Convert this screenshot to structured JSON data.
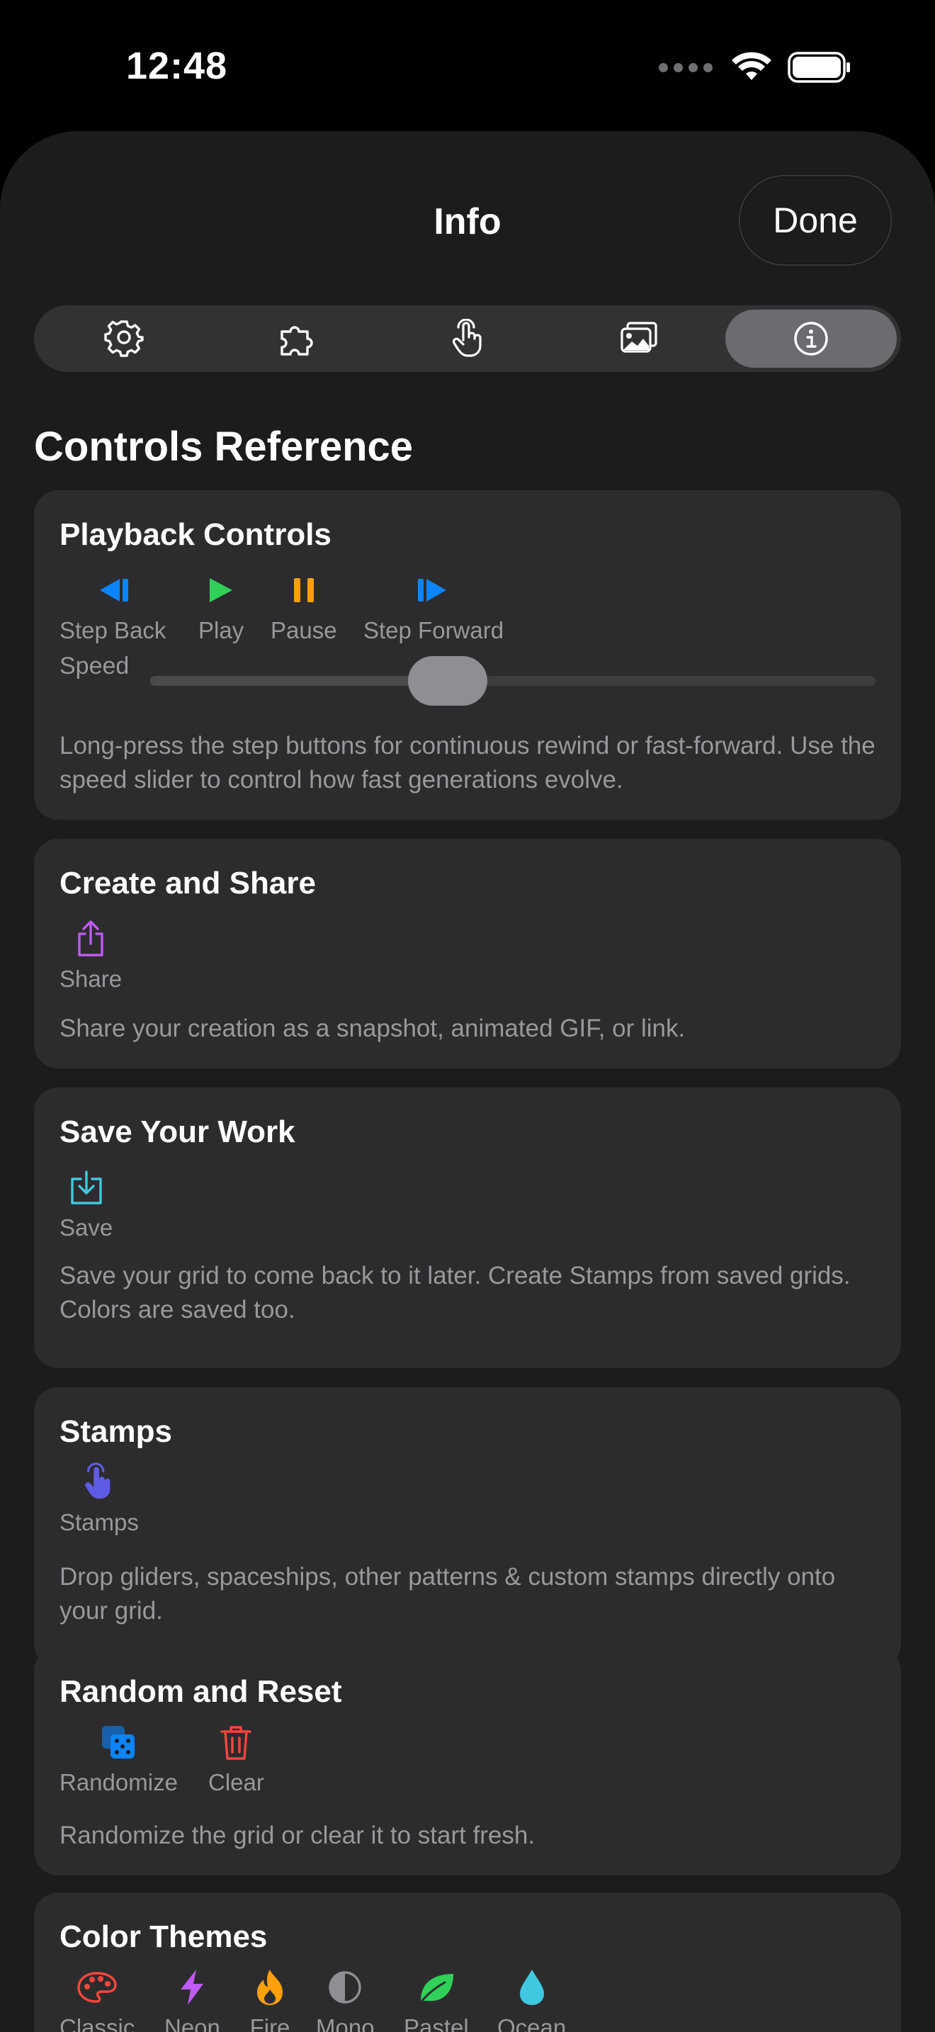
{
  "status_bar": {
    "time": "12:48"
  },
  "nav": {
    "title": "Info",
    "done_label": "Done"
  },
  "tabs": [
    {
      "icon": "gear-icon",
      "selected": false
    },
    {
      "icon": "puzzle-icon",
      "selected": false
    },
    {
      "icon": "hand-tap-icon",
      "selected": false
    },
    {
      "icon": "photo-stack-icon",
      "selected": false
    },
    {
      "icon": "info-circle-icon",
      "selected": true
    }
  ],
  "section_title": "Controls Reference",
  "playback": {
    "title": "Playback Controls",
    "controls": [
      {
        "label": "Step Back",
        "icon": "step-back-icon",
        "color": "#0a84ff"
      },
      {
        "label": "Play",
        "icon": "play-icon",
        "color": "#30d158"
      },
      {
        "label": "Pause",
        "icon": "pause-icon",
        "color": "#ff9f0a"
      },
      {
        "label": "Step Forward",
        "icon": "step-forward-icon",
        "color": "#0a84ff"
      }
    ],
    "speed_label": "Speed",
    "speed_value": 0.41,
    "description": "Long-press the step buttons for continuous rewind or fast-forward. Use the speed slider to control how fast generations evolve."
  },
  "share": {
    "title": "Create and Share",
    "controls": [
      {
        "label": "Share",
        "icon": "share-icon",
        "color": "#bf5af2"
      }
    ],
    "description": "Share your creation as a snapshot, animated GIF, or link."
  },
  "save": {
    "title": "Save Your Work",
    "controls": [
      {
        "label": "Save",
        "icon": "save-icon",
        "color": "#40c8e0"
      }
    ],
    "description": "Save your grid to come back to it later. Create Stamps from saved grids. Colors are saved too."
  },
  "stamps": {
    "title": "Stamps",
    "controls": [
      {
        "label": "Stamps",
        "icon": "stamp-hand-icon",
        "color": "#5e5ce6"
      }
    ],
    "description": "Drop gliders, spaceships, other patterns & custom stamps directly onto your grid."
  },
  "random": {
    "title": "Random and Reset",
    "controls": [
      {
        "label": "Randomize",
        "icon": "dice-icon",
        "color": "#0a84ff"
      },
      {
        "label": "Clear",
        "icon": "trash-icon",
        "color": "#ff453a"
      }
    ],
    "description": "Randomize the grid or clear it to start fresh."
  },
  "themes": {
    "title": "Color Themes",
    "controls": [
      {
        "label": "Classic",
        "icon": "palette-icon",
        "color": "#ff453a"
      },
      {
        "label": "Neon",
        "icon": "bolt-icon",
        "color": "#bf5af2"
      },
      {
        "label": "Fire",
        "icon": "flame-icon",
        "color": "#ff9f0a"
      },
      {
        "label": "Mono",
        "icon": "half-circle-icon",
        "color": "#8e8e93"
      },
      {
        "label": "Pastel",
        "icon": "leaf-icon",
        "color": "#30d158"
      },
      {
        "label": "Ocean",
        "icon": "drop-icon",
        "color": "#40c8e0"
      }
    ]
  }
}
